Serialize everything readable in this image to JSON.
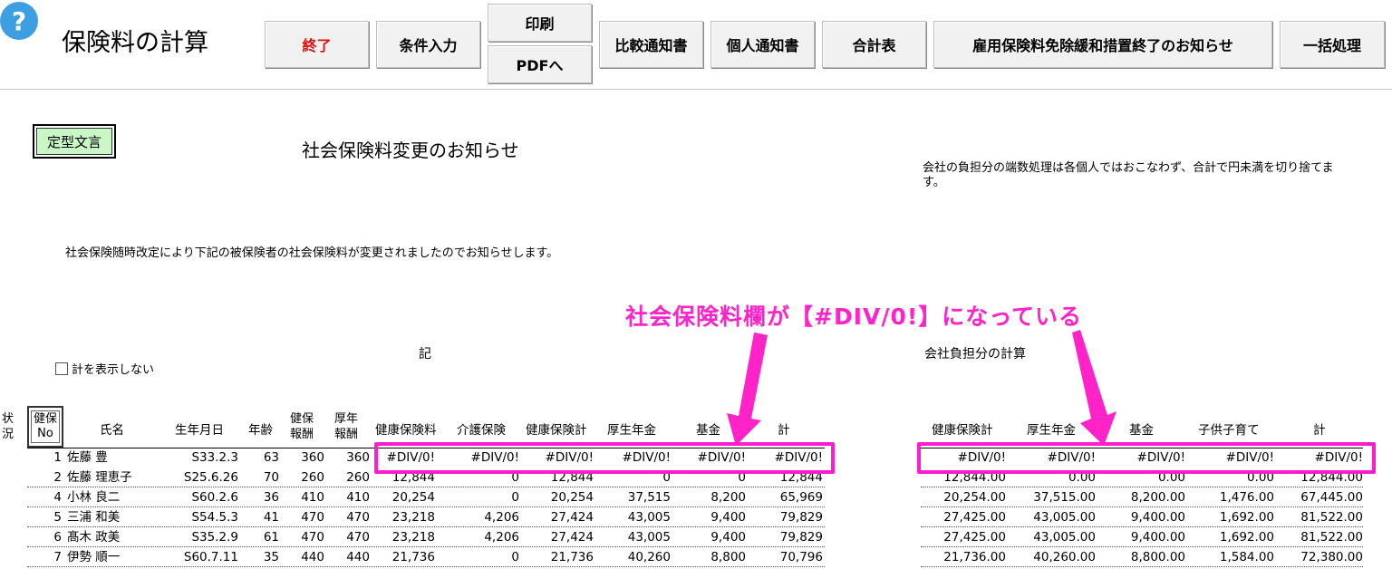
{
  "app": {
    "help_icon": "question-circle-icon",
    "help_glyph": "?",
    "title": "保険料の計算"
  },
  "toolbar": {
    "end": "終了",
    "conditions": "条件入力",
    "print": "印刷",
    "pdf": "PDFへ",
    "compare": "比較通知書",
    "personal": "個人通知書",
    "total": "合計表",
    "employment_notice": "雇用保険料免除緩和措置終了のお知らせ",
    "batch": "一括処理"
  },
  "body": {
    "template_button": "定型文言",
    "doc_title": "社会保険料変更のお知らせ",
    "note": "会社の負担分の端数処理は各個人ではおこなわず、合計で円未満を切り捨てます。",
    "intro": "社会保険随時改定により下記の被保険者の社会保険料が変更されましたのでお知らせします。",
    "callout": "社会保険料欄が【#DIV/0!】になっている",
    "ki": "記",
    "company_title": "会社負担分の計算",
    "hide_total_label": "計を表示しない"
  },
  "colors": {
    "callout": "#ff23c8",
    "template_bg": "#c9f7c5",
    "help": "#3d9ee2",
    "end_button_text": "#e01010"
  },
  "left_table": {
    "headers": {
      "status_1": "状",
      "status_2": "況",
      "kenpo_no_1": "健保",
      "kenpo_no_2": "No",
      "name": "氏名",
      "birth": "生年月日",
      "age": "年齢",
      "kenpo_pay_1": "健保",
      "kenpo_pay_2": "報酬",
      "kosei_pay_1": "厚年",
      "kosei_pay_2": "報酬",
      "health": "健康保険料",
      "care": "介護保険",
      "health_total": "健康保険計",
      "pension": "厚生年金",
      "fund": "基金",
      "total": "計"
    },
    "rows": [
      {
        "no": "1",
        "name": "佐藤 豊",
        "birth": "S33.2.3",
        "age": "63",
        "kp": "360",
        "kn": "360",
        "health": "#DIV/0!",
        "care": "#DIV/0!",
        "htotal": "#DIV/0!",
        "pension": "#DIV/0!",
        "fund": "#DIV/0!",
        "total": "#DIV/0!"
      },
      {
        "no": "2",
        "name": "佐藤 理恵子",
        "birth": "S25.6.26",
        "age": "70",
        "kp": "260",
        "kn": "260",
        "health": "12,844",
        "care": "0",
        "htotal": "12,844",
        "pension": "0",
        "fund": "0",
        "total": "12,844"
      },
      {
        "no": "4",
        "name": "小林 良二",
        "birth": "S60.2.6",
        "age": "36",
        "kp": "410",
        "kn": "410",
        "health": "20,254",
        "care": "0",
        "htotal": "20,254",
        "pension": "37,515",
        "fund": "8,200",
        "total": "65,969"
      },
      {
        "no": "5",
        "name": "三浦 和美",
        "birth": "S54.5.3",
        "age": "41",
        "kp": "470",
        "kn": "470",
        "health": "23,218",
        "care": "4,206",
        "htotal": "27,424",
        "pension": "43,005",
        "fund": "9,400",
        "total": "79,829"
      },
      {
        "no": "6",
        "name": "髙木 政美",
        "birth": "S35.2.9",
        "age": "61",
        "kp": "470",
        "kn": "470",
        "health": "23,218",
        "care": "4,206",
        "htotal": "27,424",
        "pension": "43,005",
        "fund": "9,400",
        "total": "79,829"
      },
      {
        "no": "7",
        "name": "伊勢 順一",
        "birth": "S60.7.11",
        "age": "35",
        "kp": "440",
        "kn": "440",
        "health": "21,736",
        "care": "0",
        "htotal": "21,736",
        "pension": "40,260",
        "fund": "8,800",
        "total": "70,796"
      }
    ]
  },
  "right_table": {
    "headers": {
      "health_total": "健康保険計",
      "pension": "厚生年金",
      "fund": "基金",
      "child": "子供子育て",
      "total": "計"
    },
    "rows": [
      {
        "htotal": "#DIV/0!",
        "pension": "#DIV/0!",
        "fund": "#DIV/0!",
        "child": "#DIV/0!",
        "total": "#DIV/0!"
      },
      {
        "htotal": "12,844.00",
        "pension": "0.00",
        "fund": "0.00",
        "child": "0.00",
        "total": "12,844.00"
      },
      {
        "htotal": "20,254.00",
        "pension": "37,515.00",
        "fund": "8,200.00",
        "child": "1,476.00",
        "total": "67,445.00"
      },
      {
        "htotal": "27,425.00",
        "pension": "43,005.00",
        "fund": "9,400.00",
        "child": "1,692.00",
        "total": "81,522.00"
      },
      {
        "htotal": "27,425.00",
        "pension": "43,005.00",
        "fund": "9,400.00",
        "child": "1,692.00",
        "total": "81,522.00"
      },
      {
        "htotal": "21,736.00",
        "pension": "40,260.00",
        "fund": "8,800.00",
        "child": "1,584.00",
        "total": "72,380.00"
      }
    ]
  }
}
